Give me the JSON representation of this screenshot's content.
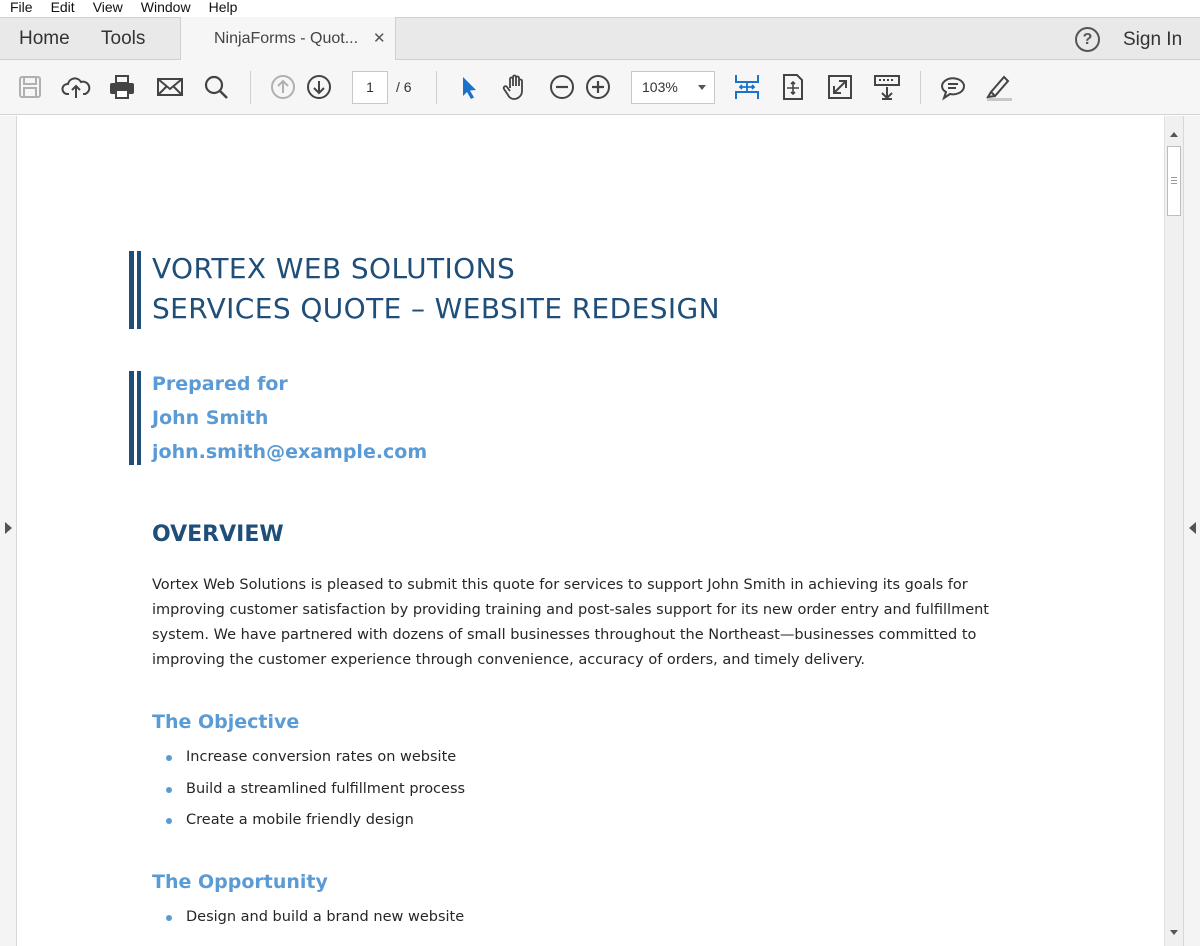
{
  "menu": [
    "File",
    "Edit",
    "View",
    "Window",
    "Help"
  ],
  "tabs": {
    "home": "Home",
    "tools": "Tools",
    "document": "NinjaForms - Quot...",
    "close": "✕",
    "help": "?",
    "signin": "Sign In"
  },
  "toolbar": {
    "page_current": "1",
    "page_total": "/ 6",
    "zoom": "103%",
    "icons": [
      "save-icon",
      "upload-cloud-icon",
      "print-icon",
      "email-icon",
      "search-icon",
      "previous-page-icon",
      "next-page-icon",
      "select-cursor-icon",
      "hand-tool-icon",
      "zoom-out-icon",
      "zoom-in-icon",
      "fit-width-icon",
      "fit-page-icon",
      "full-screen-icon",
      "read-mode-icon",
      "comment-icon",
      "highlight-icon"
    ],
    "accent": "#1a73c9"
  },
  "document": {
    "title_line1": "VORTEX WEB SOLUTIONS",
    "title_line2": "SERVICES QUOTE – WEBSITE REDESIGN",
    "prepared_label": "Prepared for",
    "client_name": "John Smith",
    "client_email": "john.smith@example.com",
    "overview_heading": "OVERVIEW",
    "overview_text": "Vortex Web Solutions is pleased to submit this quote for services to support John Smith in achieving its goals for improving customer satisfaction by providing training and post-sales support for its new order entry and fulfillment system. We have partnered with dozens of small businesses throughout the Northeast—businesses committed to improving the customer experience through convenience, accuracy of orders, and timely delivery.",
    "objective_heading": "The Objective",
    "objective_items": [
      "Increase conversion rates on website",
      "Build a streamlined fulfillment process",
      "Create a mobile friendly design"
    ],
    "opportunity_heading": "The Opportunity",
    "opportunity_items": [
      "Design and build a brand new website"
    ],
    "colors": {
      "dark_blue": "#1f4e79",
      "light_blue": "#5b9bd5"
    }
  }
}
